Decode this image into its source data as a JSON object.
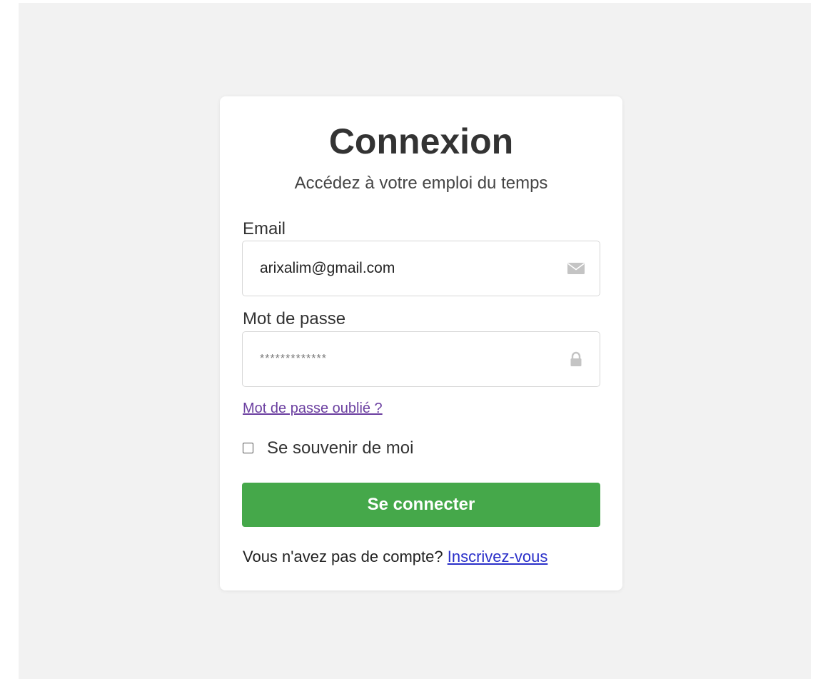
{
  "login": {
    "title": "Connexion",
    "subtitle": "Accédez à votre emploi du temps",
    "email": {
      "label": "Email",
      "value": "arixalim@gmail.com",
      "icon": "envelope-icon"
    },
    "password": {
      "label": "Mot de passe",
      "value": "*************",
      "icon": "lock-icon"
    },
    "forgot_link": "Mot de passe oublié ?",
    "remember": {
      "label": "Se souvenir de moi",
      "checked": false
    },
    "submit_label": "Se connecter",
    "signup": {
      "prompt": "Vous n'avez pas de compte? ",
      "link": "Inscrivez-vous"
    }
  },
  "colors": {
    "page_background": "#f2f2f2",
    "card_background": "#ffffff",
    "button": "#45a84a",
    "forgot_link": "#6b3fa0",
    "signup_link": "#2a2fc9"
  }
}
